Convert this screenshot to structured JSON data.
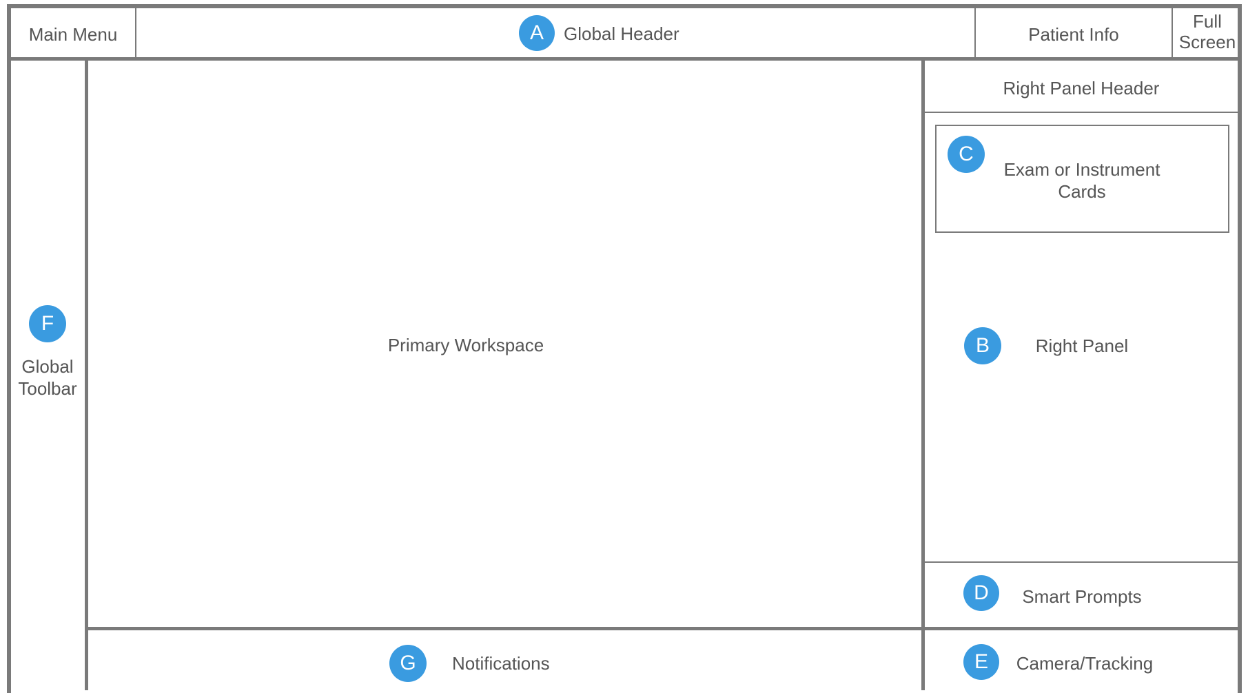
{
  "header": {
    "main_menu": "Main Menu",
    "global_header": "Global Header",
    "patient_info": "Patient Info",
    "full_screen_line1": "Full",
    "full_screen_line2": "Screen"
  },
  "toolbar": {
    "line1": "Global",
    "line2": "Toolbar"
  },
  "workspace": {
    "label": "Primary Workspace"
  },
  "right_panel": {
    "header": "Right Panel Header",
    "card_line1": "Exam or Instrument",
    "card_line2": "Cards",
    "label": "Right Panel",
    "smart_prompts": "Smart Prompts",
    "camera_tracking": "Camera/Tracking"
  },
  "notifications": {
    "label": "Notifications"
  },
  "badges": {
    "a": "A",
    "b": "B",
    "c": "C",
    "d": "D",
    "e": "E",
    "f": "F",
    "g": "G"
  },
  "colors": {
    "border": "#7a7a7a",
    "badge": "#3a9be0",
    "text": "#555555"
  }
}
